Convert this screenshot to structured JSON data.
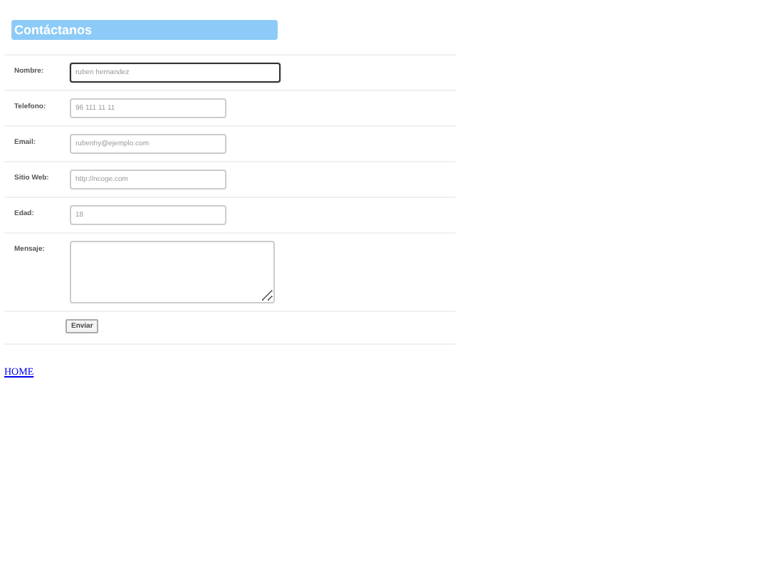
{
  "heading": "Contáctanos",
  "fields": [
    {
      "label": "Nombre:",
      "kind": "text",
      "placeholder": "ruben hernandez",
      "focused": true
    },
    {
      "label": "Telefono:",
      "kind": "text",
      "placeholder": "96 111 11 11",
      "focused": false
    },
    {
      "label": "Email:",
      "kind": "text",
      "placeholder": "rubenhy@ejemplo.com",
      "focused": false
    },
    {
      "label": "Sitio Web:",
      "kind": "text",
      "placeholder": "http://ncoge.com",
      "focused": false
    },
    {
      "label": "Edad:",
      "kind": "text",
      "placeholder": "18",
      "focused": false
    },
    {
      "label": "Mensaje:",
      "kind": "textarea",
      "focused": false
    }
  ],
  "submit": "Enviar",
  "link": "HOME"
}
